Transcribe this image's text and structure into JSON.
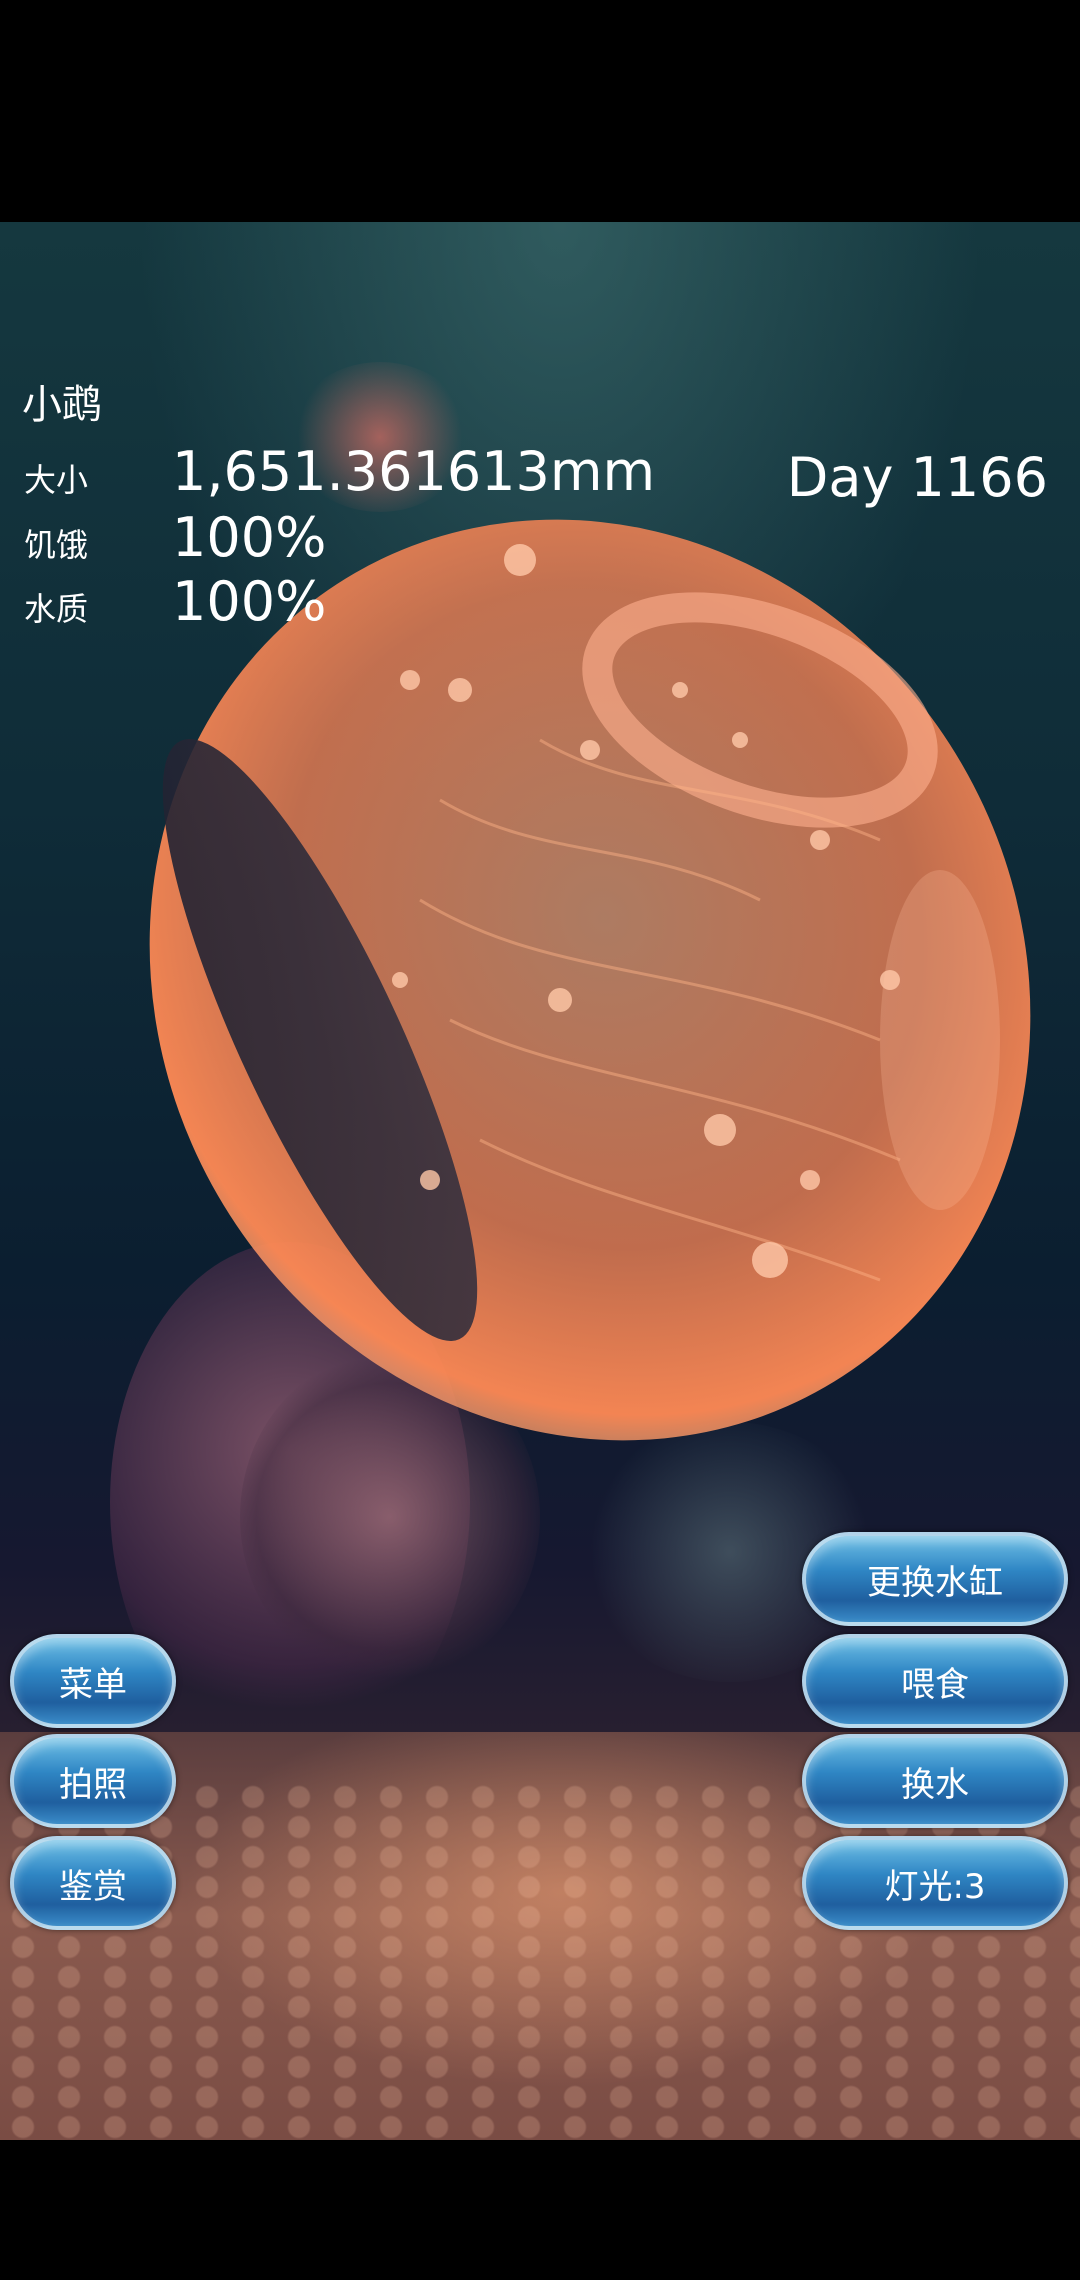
{
  "pet": {
    "name": "小鹉",
    "day": "Day 1166",
    "stats": {
      "size_label": "大小",
      "size_value": "1,651.361613mm",
      "hunger_label": "饥饿",
      "hunger_value": "100%",
      "water_label": "水质",
      "water_value": "100%"
    }
  },
  "left_buttons": {
    "menu": "菜单",
    "photo": "拍照",
    "appreciate": "鉴赏"
  },
  "right_buttons": {
    "change_tank": "更换水缸",
    "feed": "喂食",
    "change_water": "换水",
    "light": "灯光:3"
  },
  "colors": {
    "jelly": "#ff8a55",
    "button": "#2f86c4"
  }
}
